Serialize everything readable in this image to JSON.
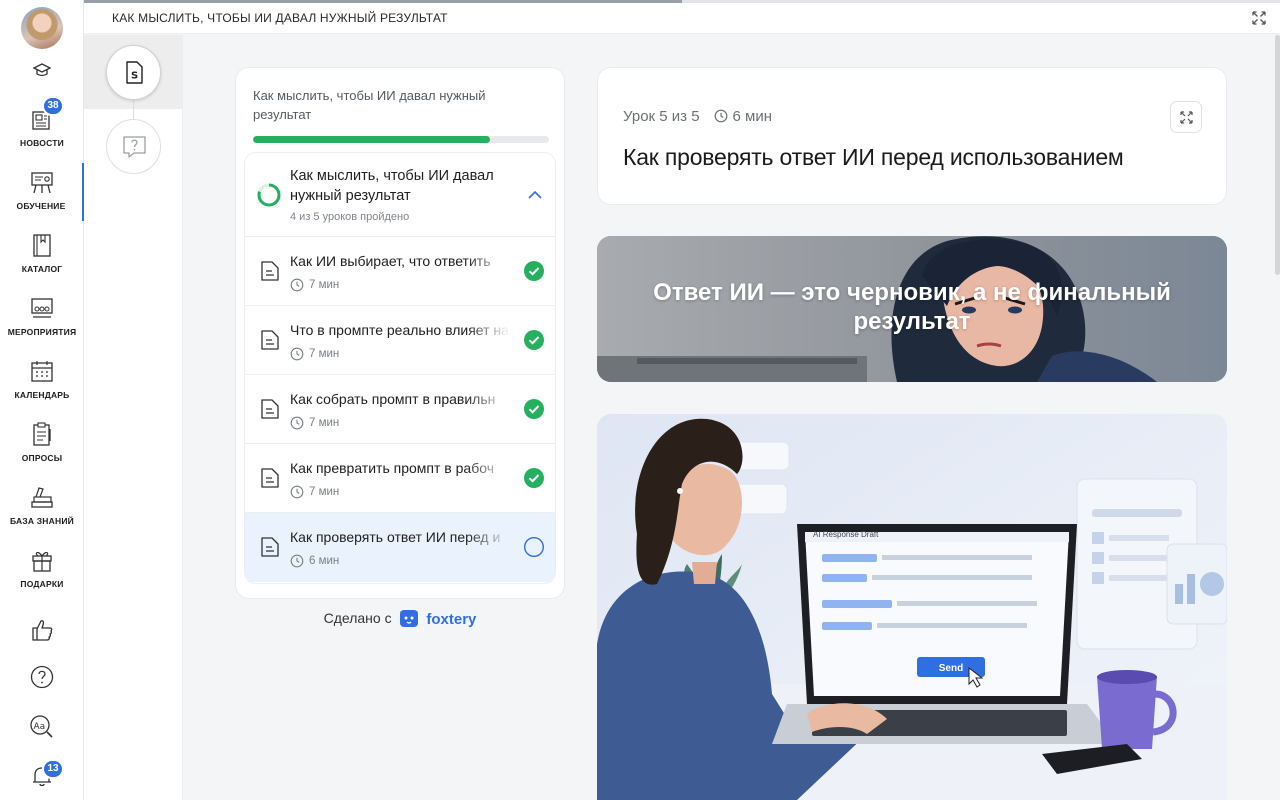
{
  "topbar": {
    "title": "КАК МЫСЛИТЬ, ЧТОБЫ ИИ ДАВАЛ НУЖНЫЙ РЕЗУЛЬТАТ",
    "progress": 0.5
  },
  "nav": {
    "items": [
      {
        "label": "НОВОСТИ",
        "badge": "38"
      },
      {
        "label": "ОБУЧЕНИЕ",
        "active": true
      },
      {
        "label": "КАТАЛОГ"
      },
      {
        "label": "МЕРОПРИЯТИЯ"
      },
      {
        "label": "КАЛЕНДАРЬ"
      },
      {
        "label": "ОПРОСЫ"
      },
      {
        "label": "БАЗА ЗНАНИЙ"
      },
      {
        "label": "ПОДАРКИ"
      }
    ],
    "notifications_badge": "13"
  },
  "course": {
    "title": "Как мыслить, чтобы ИИ давал нужный результат",
    "progress": 0.8,
    "module": {
      "title": "Как мыслить, чтобы ИИ давал нужный результат",
      "subtitle": "4 из 5 уроков пройдено"
    },
    "lessons": [
      {
        "title": "Как ИИ выбирает, что ответить",
        "duration": "7 мин",
        "done": true
      },
      {
        "title": "Что в промпте реально влияет на",
        "duration": "7 мин",
        "done": true
      },
      {
        "title": "Как собрать промпт в правильн",
        "duration": "7 мин",
        "done": true
      },
      {
        "title": "Как превратить промпт в рабоч",
        "duration": "7 мин",
        "done": true
      },
      {
        "title": "Как проверять ответ ИИ перед и",
        "duration": "6 мин",
        "done": false,
        "active": true
      }
    ],
    "made_with": "Сделано с",
    "brand": "foxtery"
  },
  "lesson": {
    "counter": "Урок 5 из 5",
    "duration": "6 мин",
    "title": "Как проверять ответ ИИ перед использованием",
    "banner_text": "Ответ ИИ — это черновик, а не финальный результат",
    "illustration": {
      "window_title": "AI Response Draft",
      "send_label": "Send"
    }
  },
  "colors": {
    "accent": "#2f6fe0",
    "success": "#25b060"
  }
}
